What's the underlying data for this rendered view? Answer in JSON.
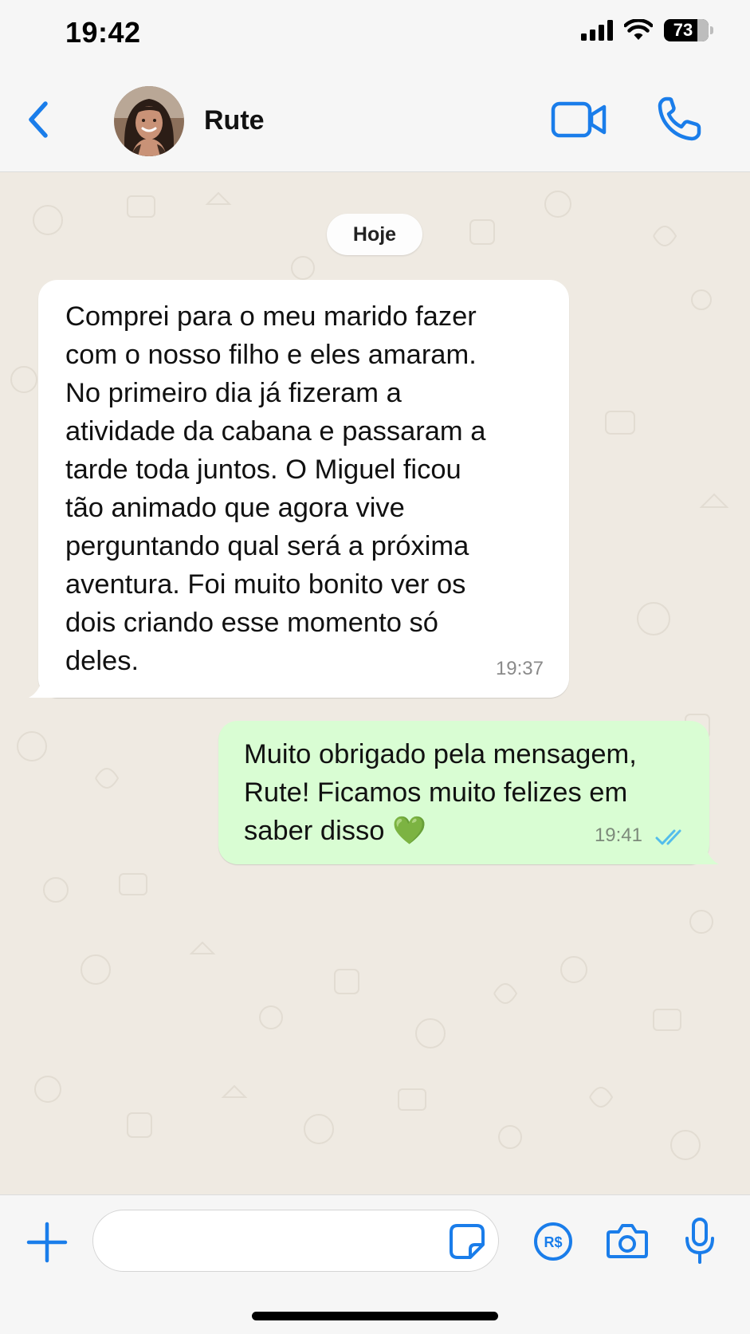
{
  "status_bar": {
    "time": "19:42",
    "battery": "73"
  },
  "header": {
    "contact_name": "Rute"
  },
  "chat": {
    "date_label": "Hoje",
    "messages": [
      {
        "direction": "incoming",
        "text": "Comprei para o meu marido fazer\ncom o nosso filho e eles amaram.\nNo primeiro dia já fizeram a\natividade da cabana e passaram a\ntarde toda juntos. O Miguel ficou\ntão animado que agora vive\nperguntando qual será a próxima\naventura. Foi muito bonito ver os\ndois criando esse momento só\ndeles.",
        "time": "19:37"
      },
      {
        "direction": "outgoing",
        "text": "Muito obrigado pela mensagem,\nRute! Ficamos muito felizes em\nsaber disso 💚",
        "time": "19:41",
        "status": "read"
      }
    ]
  },
  "composer": {
    "value": "",
    "placeholder": ""
  },
  "colors": {
    "accent": "#1a7dea",
    "chat_background": "#efeae2",
    "incoming_bubble": "#ffffff",
    "outgoing_bubble": "#d9fdd3",
    "read_ticks": "#53bdeb"
  },
  "icons": {
    "back": "chevron-left-icon",
    "video": "video-camera-icon",
    "call": "phone-icon",
    "plus": "plus-icon",
    "sticker": "sticker-icon",
    "payment": "currency-brl-icon",
    "camera": "camera-icon",
    "mic": "microphone-icon"
  }
}
